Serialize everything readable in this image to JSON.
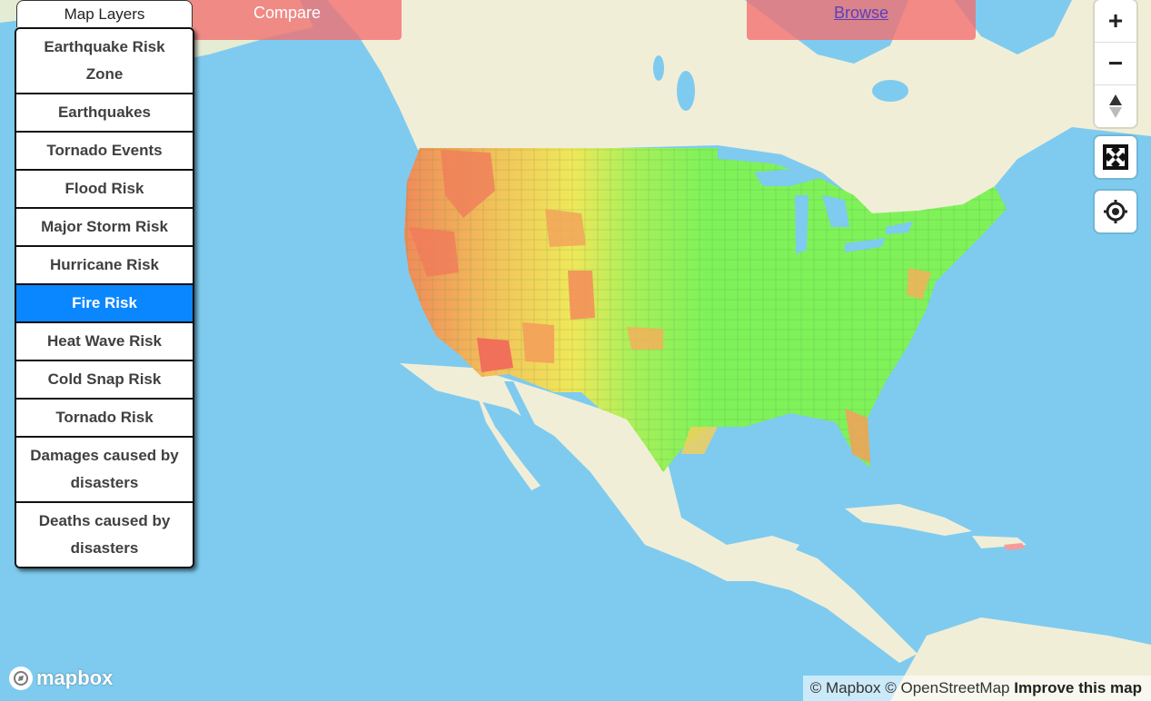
{
  "layers": {
    "title": "Map Layers",
    "items": [
      {
        "label": "Earthquake Risk Zone",
        "active": false
      },
      {
        "label": "Earthquakes",
        "active": false
      },
      {
        "label": "Tornado Events",
        "active": false
      },
      {
        "label": "Flood Risk",
        "active": false
      },
      {
        "label": "Major Storm Risk",
        "active": false
      },
      {
        "label": "Hurricane Risk",
        "active": false
      },
      {
        "label": "Fire Risk",
        "active": true
      },
      {
        "label": "Heat Wave Risk",
        "active": false
      },
      {
        "label": "Cold Snap Risk",
        "active": false
      },
      {
        "label": "Tornado Risk",
        "active": false
      },
      {
        "label": "Damages caused by disasters",
        "active": false
      },
      {
        "label": "Deaths caused by disasters",
        "active": false
      }
    ]
  },
  "top": {
    "compare": "Compare",
    "browse": "Browse"
  },
  "controls": {
    "zoom_in": "+",
    "zoom_out": "−"
  },
  "logo": "mapbox",
  "attribution": {
    "mapbox": "© Mapbox",
    "osm": "© OpenStreetMap",
    "improve": "Improve this map"
  },
  "colors": {
    "water": "#7ecbef",
    "land": "#f1eed8",
    "low_risk": "#7ff25a",
    "moderate_risk": "#f0ef5a",
    "high_risk": "#f79a5a",
    "very_high_risk": "#f0705a",
    "active_layer": "#0a86ff"
  }
}
